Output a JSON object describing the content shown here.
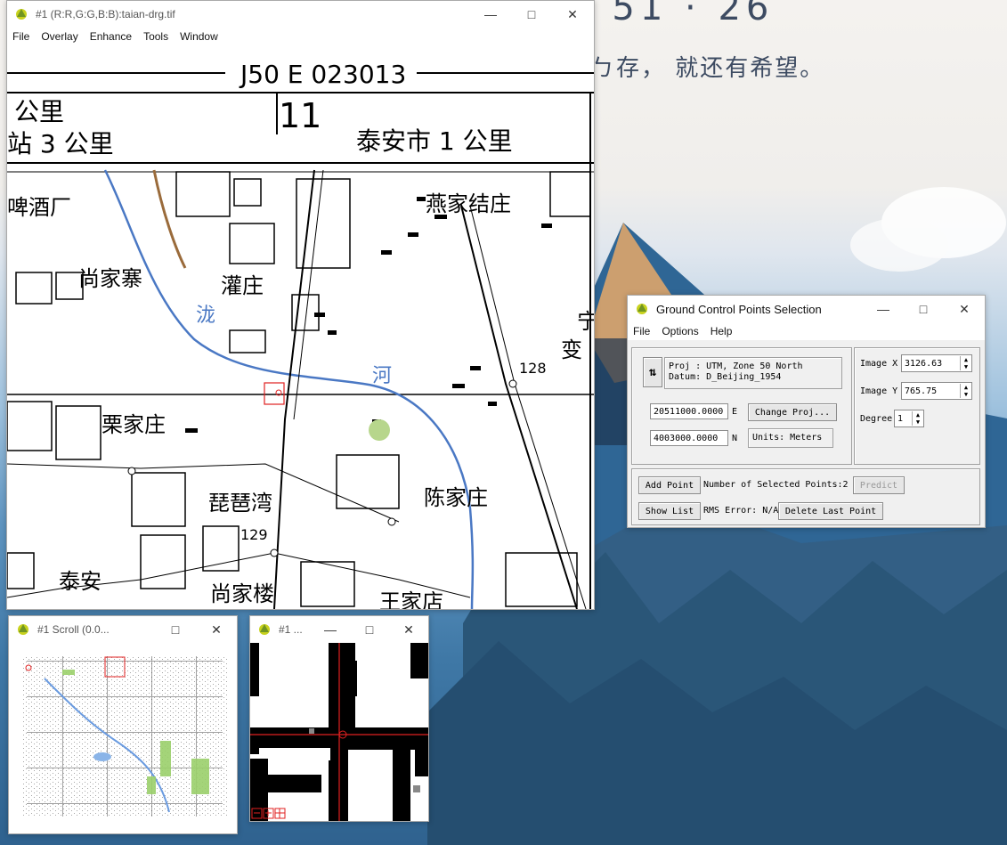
{
  "wallpaper": {
    "clock_text": "· 51 · 26",
    "quote_text": "希望还在，就还有希望。",
    "quote_visible": "ㄅ存， 就还有希望。"
  },
  "main_window": {
    "title": "#1 (R:R,G:G,B:B):taian-drg.tif",
    "menu": [
      "File",
      "Overlay",
      "Enhance",
      "Tools",
      "Window"
    ],
    "map": {
      "sheet_code": "J50 E 023013",
      "edge_labels": {
        "top_left_a": "公里",
        "top_left_b": "站 3 公里",
        "top_mid": "泰安市 1 公里"
      },
      "places": [
        "啤酒厂",
        "燕家结庄",
        "尚家寨",
        "灌庄",
        "宁",
        "变",
        "泷",
        "河",
        "128",
        "栗家庄",
        "陈家庄",
        "琵琶湾",
        "129",
        "泰安",
        "尚家楼",
        "王家店",
        "中"
      ]
    }
  },
  "scroll_window": {
    "title": "#1 Scroll (0.0..."
  },
  "zoom_window": {
    "title": "#1 ..."
  },
  "gcp_window": {
    "title": "Ground Control Points Selection",
    "menu": [
      "File",
      "Options",
      "Help"
    ],
    "proj_line1": "Proj : UTM, Zone 50 North",
    "proj_line2": "Datum: D_Beijing_1954",
    "easting": "20511000.0000",
    "easting_suffix": "E",
    "northing": "4003000.0000",
    "northing_suffix": "N",
    "change_proj": "Change Proj...",
    "units": "Units: Meters",
    "image_x_label": "Image X",
    "image_x": "3126.63",
    "image_y_label": "Image Y",
    "image_y": "765.75",
    "degree_label": "Degree",
    "degree": "1",
    "add_point": "Add Point",
    "selected_label": "Number of Selected Points:",
    "selected_count": "2",
    "predict": "Predict",
    "show_list": "Show List",
    "rms_error": "RMS Error: N/A",
    "delete_last": "Delete Last Point"
  }
}
